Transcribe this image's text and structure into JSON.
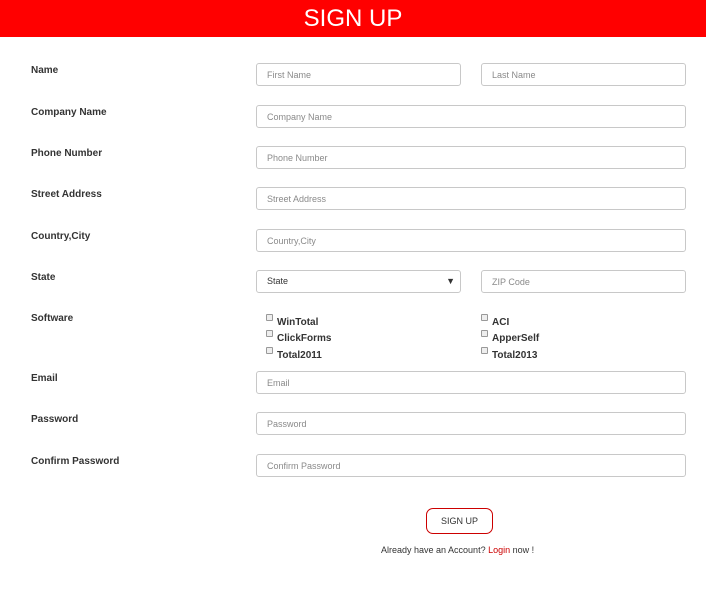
{
  "header": {
    "title": "SIGN UP"
  },
  "fields": {
    "name_label": "Name",
    "first_name_placeholder": "First Name",
    "last_name_placeholder": "Last Name",
    "company_label": "Company Name",
    "company_placeholder": "Company Name",
    "phone_label": "Phone Number",
    "phone_placeholder": "Phone Number",
    "street_label": "Street Address",
    "street_placeholder": "Street Address",
    "country_label": "Country,City",
    "country_placeholder": "Country,City",
    "state_label": "State",
    "state_selected": "State",
    "zip_placeholder": "ZIP Code",
    "software_label": "Software",
    "email_label": "Email",
    "email_placeholder": "Email",
    "password_label": "Password",
    "password_placeholder": "Password",
    "confirm_label": "Confirm Password",
    "confirm_placeholder": "Confirm Password"
  },
  "software_options": [
    "WinTotal",
    "ClickForms",
    "Total2011",
    "ACI",
    "ApperSelf",
    "Total2013"
  ],
  "actions": {
    "signup_button": "SIGN UP",
    "already_text": "Already have an Account?",
    "login_link": "Login",
    "now_text": "now !"
  }
}
